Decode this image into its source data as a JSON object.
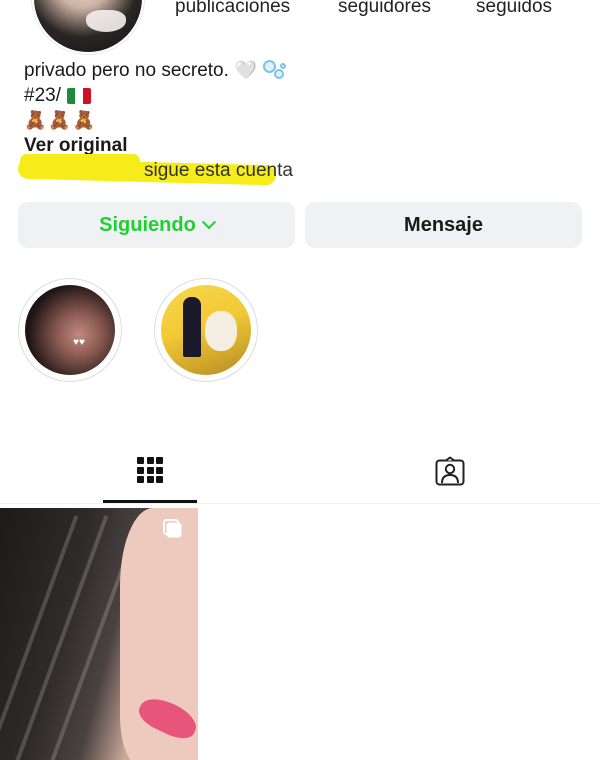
{
  "profile": {
    "stats": {
      "posts_label": "publicaciones",
      "followers_label": "seguidores",
      "following_label": "seguidos"
    },
    "bio": {
      "line1": "privado pero no secreto.",
      "line1_heart": "🤍",
      "line2": "#23/",
      "line3": "🧸🧸🧸",
      "see_translation": "Ver original",
      "followed_by": "sigue esta cuenta"
    }
  },
  "actions": {
    "following_label": "Siguiendo",
    "message_label": "Mensaje",
    "following_color": "#1ed12f"
  },
  "highlights": [
    {
      "id": "highlight-1"
    },
    {
      "id": "highlight-2"
    }
  ],
  "tabs": [
    {
      "icon": "grid-icon",
      "active": true
    },
    {
      "icon": "tagged-person-icon",
      "active": false
    }
  ],
  "posts": [
    {
      "icon": "multiple-posts-icon"
    }
  ]
}
